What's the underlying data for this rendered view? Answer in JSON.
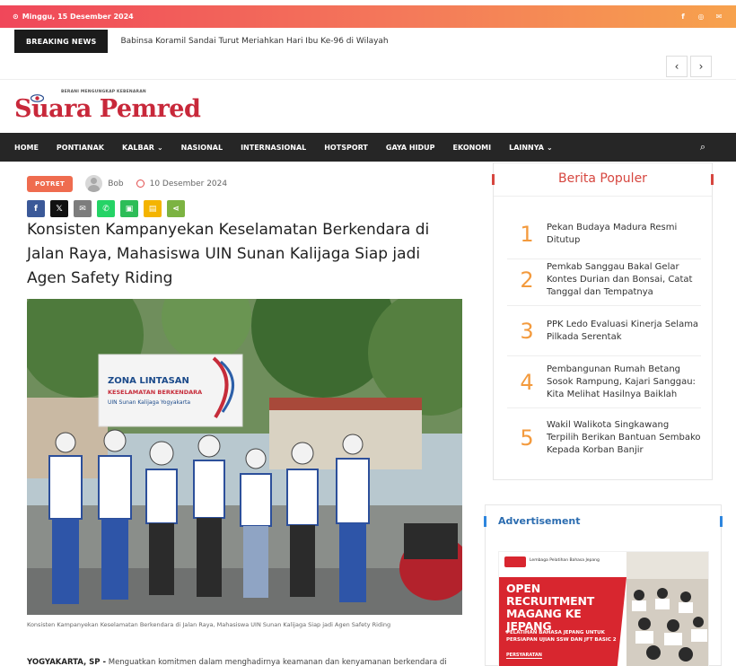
{
  "topbar": {
    "date": "Minggu, 15 Desember 2024",
    "social": [
      "facebook-icon",
      "instagram-icon",
      "email-icon"
    ],
    "social_glyphs": [
      "f",
      "◎",
      "✉"
    ]
  },
  "breaking": {
    "label": "BREAKING NEWS",
    "text": "Babinsa Koramil Sandai Turut Meriahkan Hari Ibu Ke-96 di Wilayah",
    "prev": "‹",
    "next": "›"
  },
  "logo": {
    "tagline": "BERANI MENGUNGKAP KEBENARAN",
    "name": "Suara Pemred"
  },
  "nav": {
    "items": [
      "HOME",
      "PONTIANAK",
      "KALBAR",
      "NASIONAL",
      "INTERNASIONAL",
      "HOTSPORT",
      "GAYA HIDUP",
      "EKONOMI",
      "LAINNYA"
    ],
    "search_glyph": "⌕"
  },
  "article": {
    "category": "POTRET",
    "author": "Bob",
    "date": "10 Desember 2024",
    "share": [
      {
        "glyph": "f",
        "color": "#3b5998"
      },
      {
        "glyph": "𝕏",
        "color": "#111111"
      },
      {
        "glyph": "✉",
        "color": "#7d7d7d"
      },
      {
        "glyph": "✆",
        "color": "#25d366"
      },
      {
        "glyph": "▣",
        "color": "#2dbd58"
      },
      {
        "glyph": "▤",
        "color": "#f4b400"
      },
      {
        "glyph": "⋖",
        "color": "#7cb342"
      }
    ],
    "title": "Konsisten Kampanyekan Keselamatan Berkendara di Jalan Raya, Mahasiswa UIN Sunan Kalijaga Siap jadi Agen Safety Riding",
    "photo_banner": {
      "line1": "ZONA LINTASAN",
      "line2": "KESELAMATAN BERKENDARA",
      "line3": "UIN Sunan Kalijaga Yogyakarta"
    },
    "caption": "Konsisten Kampanyekan Keselamatan Berkendara di Jalan Raya, Mahasiswa UIN Sunan Kalijaga Siap jadi Agen Safety Riding",
    "lead_place": "YOGYAKARTA, SP -",
    "lead_text": " Menguatkan komitmen dalam menghadirnya keamanan dan kenyamanan berkendara di"
  },
  "popular": {
    "heading": "Berita Populer",
    "items": [
      {
        "num": "1",
        "title": "Pekan Budaya Madura Resmi Ditutup"
      },
      {
        "num": "2",
        "title": "Pemkab Sanggau Bakal Gelar Kontes Durian dan Bonsai, Catat Tanggal dan Tempatnya"
      },
      {
        "num": "3",
        "title": "PPK Ledo Evaluasi Kinerja Selama Pilkada Serentak"
      },
      {
        "num": "4",
        "title": "Pembangunan Rumah Betang Sosok Rampung, Kajari Sanggau: Kita Melihat Hasilnya Baiklah"
      },
      {
        "num": "5",
        "title": "Wakil Walikota Singkawang Terpilih Berikan Bantuan Sembako Kepada Korban Banjir"
      }
    ]
  },
  "advert": {
    "heading": "Advertisement",
    "org": "Lembaga Pelatihan Bahasa Jepang",
    "headline": "OPEN RECRUITMENT MAGANG KE JEPANG",
    "sub": "PELATIHAN BAHASA JEPANG UNTUK PERSIAPAN UJIAN SSW DAN JFT BASIC 2",
    "persyaratan": "PERSYARATAN"
  }
}
